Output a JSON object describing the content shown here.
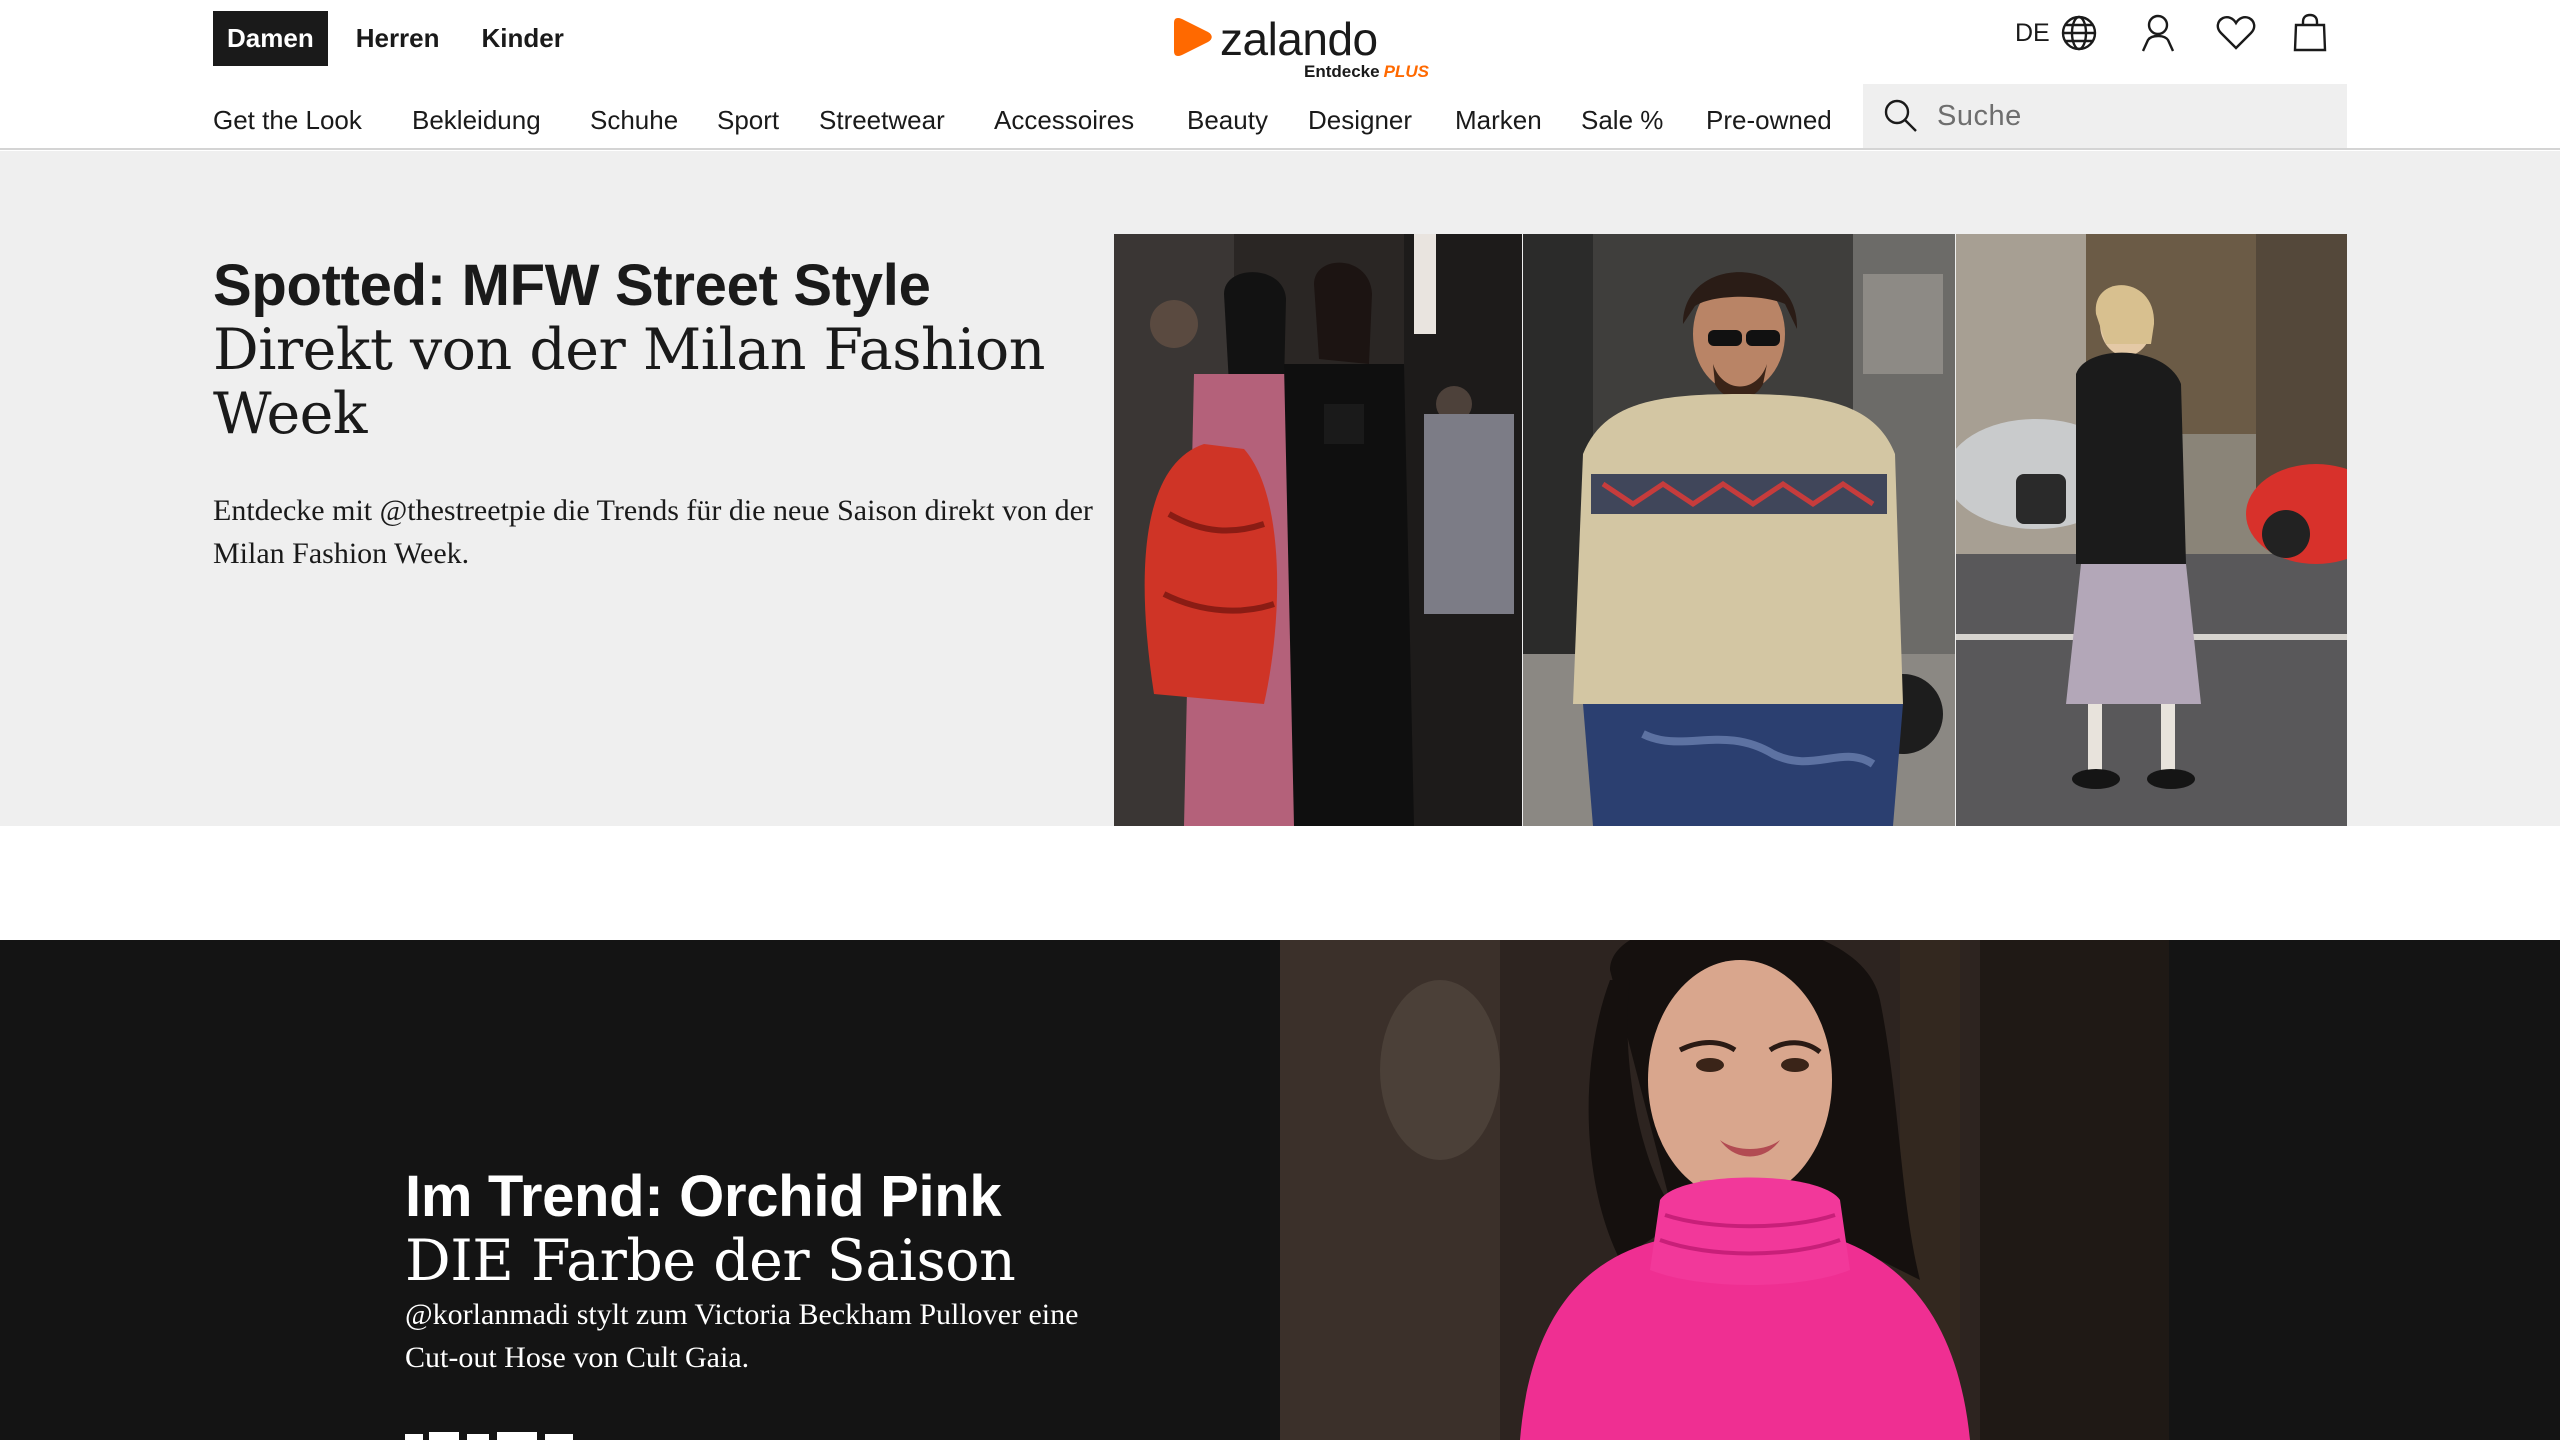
{
  "header": {
    "gender_tabs": [
      {
        "label": "Damen",
        "active": true
      },
      {
        "label": "Herren",
        "active": false
      },
      {
        "label": "Kinder",
        "active": false
      }
    ],
    "logo": {
      "wordmark": "zalando",
      "sub": "Entdecke",
      "plus": "PLUS",
      "accent": "#ff6900"
    },
    "language": "DE",
    "icons": [
      "globe-icon",
      "user-icon",
      "heart-icon",
      "bag-icon"
    ],
    "nav": [
      "Get the Look",
      "Bekleidung",
      "Schuhe",
      "Sport",
      "Streetwear",
      "Accessoires",
      "Beauty",
      "Designer",
      "Marken",
      "Sale %",
      "Pre-owned"
    ],
    "search": {
      "placeholder": "Suche"
    }
  },
  "teaser1": {
    "headline": "Spotted: MFW Street Style",
    "subline": "Direkt von der Milan Fashion Week",
    "body": "Entdecke mit @thestreetpie die Trends für die neue Saison direkt von der Milan Fashion Week."
  },
  "teaser2": {
    "headline": "Im Trend: Orchid Pink",
    "subline": "DIE Farbe der Saison",
    "body": "@korlanmadi stylt zum Victoria Beckham Pullover eine Cut-out Hose von Cult Gaia."
  }
}
